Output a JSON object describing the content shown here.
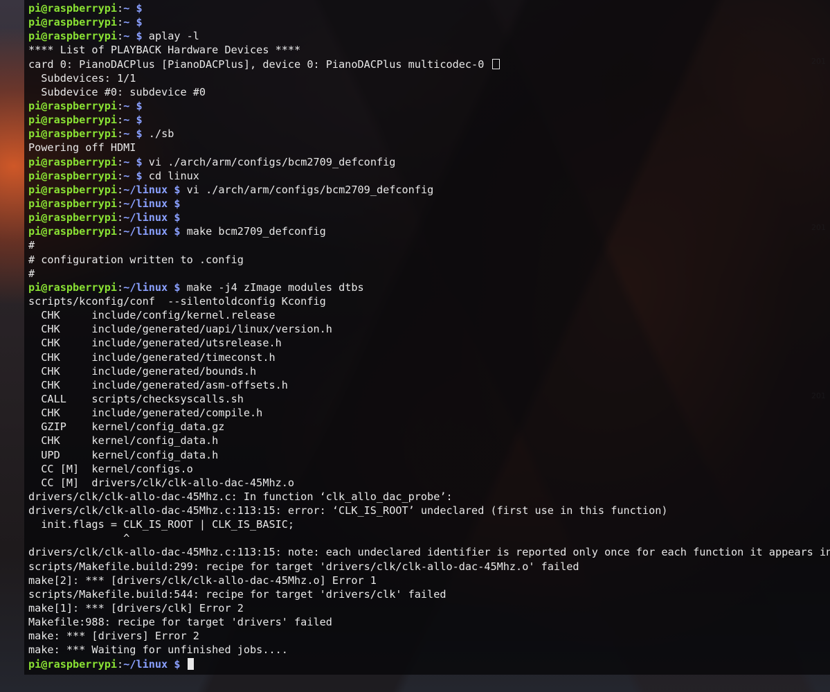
{
  "prompt": {
    "user": "pi@raspberrypi",
    "sep": ":",
    "dollar": "$"
  },
  "watermarks": [
    "201",
    "201",
    "201"
  ],
  "lines": [
    {
      "p": "~",
      "c": ""
    },
    {
      "p": "~",
      "c": ""
    },
    {
      "p": "~",
      "c": "aplay -l"
    },
    {
      "o": "**** List of PLAYBACK Hardware Devices ****"
    },
    {
      "o": "card 0: PianoDACPlus [PianoDACPlus], device 0: PianoDACPlus multicodec-0 ",
      "box": true
    },
    {
      "o": "  Subdevices: 1/1"
    },
    {
      "o": "  Subdevice #0: subdevice #0"
    },
    {
      "p": "~",
      "c": ""
    },
    {
      "p": "~",
      "c": ""
    },
    {
      "p": "~",
      "c": "./sb"
    },
    {
      "o": "Powering off HDMI"
    },
    {
      "p": "~",
      "c": "vi ./arch/arm/configs/bcm2709_defconfig"
    },
    {
      "p": "~",
      "c": "cd linux"
    },
    {
      "p": "~/linux",
      "c": "vi ./arch/arm/configs/bcm2709_defconfig"
    },
    {
      "p": "~/linux",
      "c": ""
    },
    {
      "p": "~/linux",
      "c": ""
    },
    {
      "p": "~/linux",
      "c": "make bcm2709_defconfig"
    },
    {
      "o": "#"
    },
    {
      "o": "# configuration written to .config"
    },
    {
      "o": "#"
    },
    {
      "p": "~/linux",
      "c": "make -j4 zImage modules dtbs"
    },
    {
      "o": "scripts/kconfig/conf  --silentoldconfig Kconfig"
    },
    {
      "o": "  CHK     include/config/kernel.release"
    },
    {
      "o": "  CHK     include/generated/uapi/linux/version.h"
    },
    {
      "o": "  CHK     include/generated/utsrelease.h"
    },
    {
      "o": "  CHK     include/generated/timeconst.h"
    },
    {
      "o": "  CHK     include/generated/bounds.h"
    },
    {
      "o": "  CHK     include/generated/asm-offsets.h"
    },
    {
      "o": "  CALL    scripts/checksyscalls.sh"
    },
    {
      "o": "  CHK     include/generated/compile.h"
    },
    {
      "o": "  GZIP    kernel/config_data.gz"
    },
    {
      "o": "  CHK     kernel/config_data.h"
    },
    {
      "o": "  UPD     kernel/config_data.h"
    },
    {
      "o": "  CC [M]  kernel/configs.o"
    },
    {
      "o": "  CC [M]  drivers/clk/clk-allo-dac-45Mhz.o"
    },
    {
      "o": "drivers/clk/clk-allo-dac-45Mhz.c: In function ‘clk_allo_dac_probe’:"
    },
    {
      "o": "drivers/clk/clk-allo-dac-45Mhz.c:113:15: error: ‘CLK_IS_ROOT’ undeclared (first use in this function)"
    },
    {
      "o": "  init.flags = CLK_IS_ROOT | CLK_IS_BASIC;"
    },
    {
      "o": "               ^"
    },
    {
      "o": "drivers/clk/clk-allo-dac-45Mhz.c:113:15: note: each undeclared identifier is reported only once for each function it appears in"
    },
    {
      "o": "scripts/Makefile.build:299: recipe for target 'drivers/clk/clk-allo-dac-45Mhz.o' failed"
    },
    {
      "o": "make[2]: *** [drivers/clk/clk-allo-dac-45Mhz.o] Error 1"
    },
    {
      "o": "scripts/Makefile.build:544: recipe for target 'drivers/clk' failed"
    },
    {
      "o": "make[1]: *** [drivers/clk] Error 2"
    },
    {
      "o": "Makefile:988: recipe for target 'drivers' failed"
    },
    {
      "o": "make: *** [drivers] Error 2"
    },
    {
      "o": "make: *** Waiting for unfinished jobs...."
    },
    {
      "p": "~/linux",
      "c": "",
      "cursor": true
    }
  ]
}
